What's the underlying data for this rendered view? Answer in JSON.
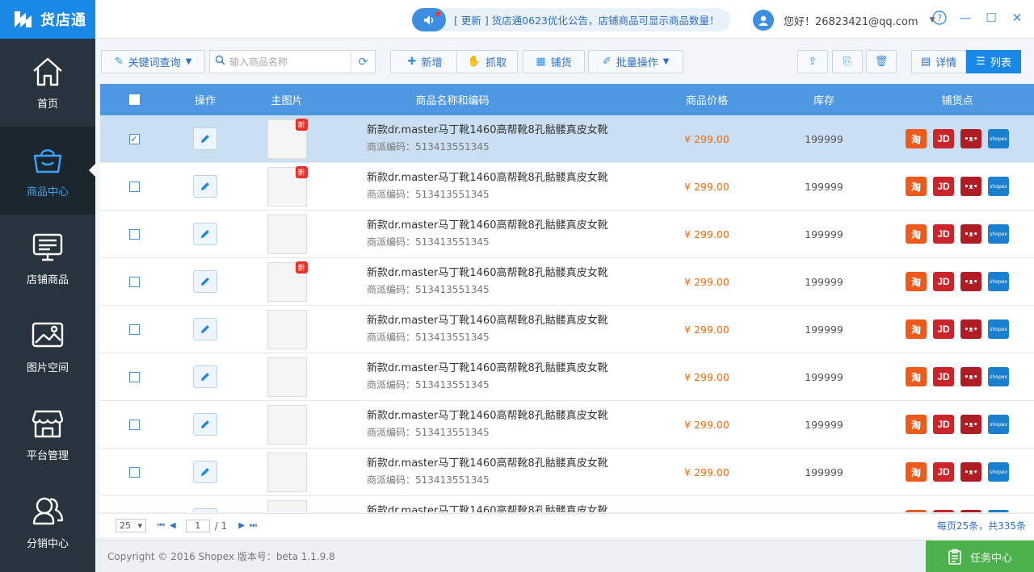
{
  "app": {
    "logo_text": "货店通"
  },
  "sidebar": {
    "items": [
      {
        "label": "首页",
        "icon": "home-icon"
      },
      {
        "label": "商品中心",
        "icon": "basket-icon",
        "active": true
      },
      {
        "label": "店铺商品",
        "icon": "monitor-icon"
      },
      {
        "label": "图片空间",
        "icon": "image-icon"
      },
      {
        "label": "平台管理",
        "icon": "store-icon"
      },
      {
        "label": "分销中心",
        "icon": "people-icon"
      }
    ]
  },
  "topbar": {
    "notice": "[ 更新 ]  货店通0623优化公告，店铺商品可显示商品数量！",
    "user_greeting": "您好！26823421@qq.com"
  },
  "toolbar": {
    "keyword_query": "关键词查询",
    "search_placeholder": "输入商品名称",
    "add": "新增",
    "grab": "抓取",
    "distribute": "铺货",
    "batch": "批量操作",
    "view_detail": "详情",
    "view_list": "列表"
  },
  "table": {
    "headers": {
      "op": "操作",
      "image": "主图片",
      "name": "商品名称和编码",
      "price": "商品价格",
      "stock": "库存",
      "shops": "铺货点"
    },
    "rows": [
      {
        "name": "新款dr.master马丁靴1460高帮靴8孔骷髅真皮女靴",
        "code": "商派编码：513413551345",
        "price": "¥ 299.00",
        "stock": "199999",
        "new": true,
        "checked": true
      },
      {
        "name": "新款dr.master马丁靴1460高帮靴8孔骷髅真皮女靴",
        "code": "商派编码：513413551345",
        "price": "¥ 299.00",
        "stock": "199999",
        "new": true,
        "checked": false
      },
      {
        "name": "新款dr.master马丁靴1460高帮靴8孔骷髅真皮女靴",
        "code": "商派编码：513413551345",
        "price": "¥ 299.00",
        "stock": "199999",
        "new": false,
        "checked": false
      },
      {
        "name": "新款dr.master马丁靴1460高帮靴8孔骷髅真皮女靴",
        "code": "商派编码：513413551345",
        "price": "¥ 299.00",
        "stock": "199999",
        "new": true,
        "checked": false
      },
      {
        "name": "新款dr.master马丁靴1460高帮靴8孔骷髅真皮女靴",
        "code": "商派编码：513413551345",
        "price": "¥ 299.00",
        "stock": "199999",
        "new": false,
        "checked": false
      },
      {
        "name": "新款dr.master马丁靴1460高帮靴8孔骷髅真皮女靴",
        "code": "商派编码：513413551345",
        "price": "¥ 299.00",
        "stock": "199999",
        "new": false,
        "checked": false
      },
      {
        "name": "新款dr.master马丁靴1460高帮靴8孔骷髅真皮女靴",
        "code": "商派编码：513413551345",
        "price": "¥ 299.00",
        "stock": "199999",
        "new": false,
        "checked": false
      },
      {
        "name": "新款dr.master马丁靴1460高帮靴8孔骷髅真皮女靴",
        "code": "商派编码：513413551345",
        "price": "¥ 299.00",
        "stock": "199999",
        "new": false,
        "checked": false
      },
      {
        "name": "新款dr.master马丁靴1460高帮靴8孔骷髅真皮女靴",
        "code": "商派编码：513413551345",
        "price": "¥ 299.00",
        "stock": "199999",
        "new": false,
        "checked": false
      }
    ],
    "new_badge": "新",
    "shop_labels": {
      "taobao": "淘",
      "jd": "JD",
      "tmall": "•ᴥ•",
      "shopex": "shopex"
    }
  },
  "pager": {
    "page_size": "25",
    "current_page": "1",
    "total_pages": "/ 1",
    "summary": "每页25条，共335条"
  },
  "footer": {
    "copyright": "Copyright © 2016 Shopex   版本号：beta 1.1.9.8",
    "task_center": "任务中心"
  },
  "colors": {
    "brand": "#1a88e6",
    "sidebar": "#27333d",
    "header_row": "#4d97e3",
    "price": "#f26a0b",
    "task": "#4cb04c"
  }
}
